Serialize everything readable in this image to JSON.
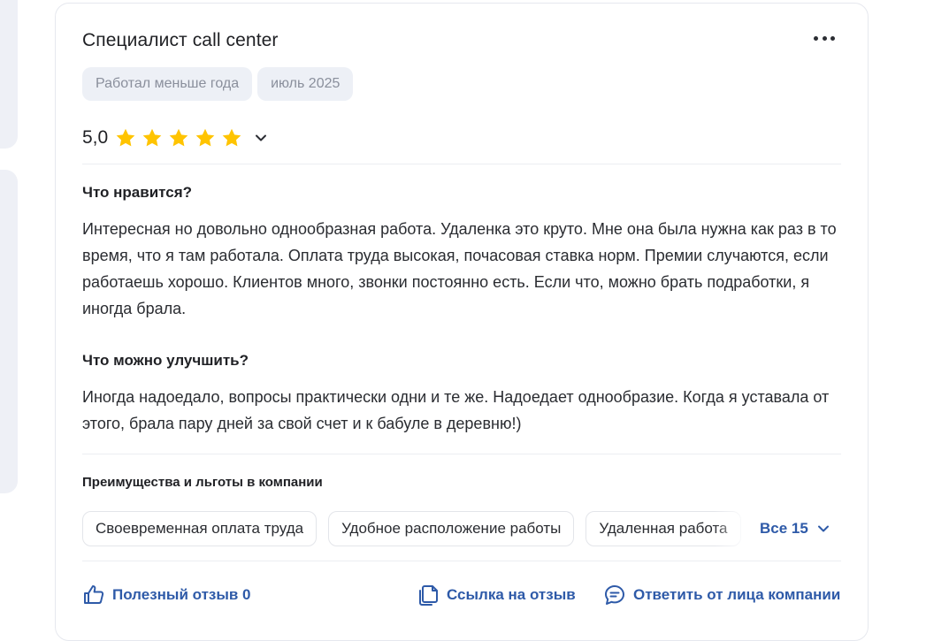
{
  "review": {
    "job_title": "Специалист call center",
    "tags": [
      "Работал меньше года",
      "июль 2025"
    ],
    "rating": {
      "value_text": "5,0",
      "stars": 5,
      "max_stars": 5,
      "star_color": "#ffc400"
    },
    "likes": {
      "heading": "Что нравится?",
      "text": "Интересная но довольно однообразная работа. Удаленка это круто. Мне она была нужна как раз в то время, что я там работала. Оплата труда высокая, почасовая ставка норм. Премии случаются, если работаешь хорошо. Клиентов много, звонки постоянно есть. Если что, можно брать подработки, я иногда брала."
    },
    "improve": {
      "heading": "Что можно улучшить?",
      "text": "Иногда надоедало, вопросы практически одни и те же. Надоедает однообразие. Когда я уставала от этого, брала пару дней за свой счет и к бабуле в деревню!)"
    },
    "benefits": {
      "heading": "Преимущества и льготы в компании",
      "items": [
        "Своевременная оплата труда",
        "Удобное расположение работы",
        "Удаленная работа"
      ],
      "all_label": "Все 15"
    },
    "actions": {
      "helpful_label": "Полезный отзыв 0",
      "link_label": "Ссылка на отзыв",
      "reply_label": "Ответить от лица компании"
    }
  },
  "colors": {
    "accent": "#2e5aa8",
    "chip_bg": "#edf0f6",
    "chip_text": "#8a8f9c",
    "panel_bg": "#eef0f6"
  },
  "icons": {
    "more": "more-horizontal-icon",
    "star": "star-icon",
    "chevron": "chevron-down-icon",
    "thumbs_up": "thumbs-up-icon",
    "copy_link": "copy-icon",
    "reply": "chat-bubble-icon"
  }
}
